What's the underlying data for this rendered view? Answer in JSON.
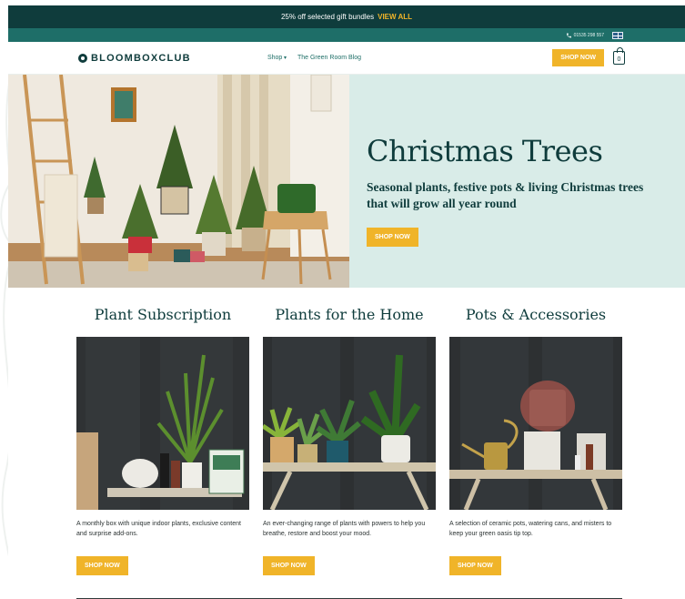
{
  "announcement": {
    "text": "25% off selected gift bundles",
    "link": "VIEW ALL"
  },
  "utility": {
    "phone": "01535 298 557"
  },
  "nav": {
    "logo": "BLOOMBOXCLUB",
    "links": [
      {
        "label": "Shop",
        "has_caret": true
      },
      {
        "label": "The Green Room Blog",
        "has_caret": false
      }
    ],
    "shop_now": "SHOP NOW",
    "cart_count": "0"
  },
  "hero": {
    "title": "Christmas Trees",
    "subtitle": "Seasonal plants, festive pots & living Christmas trees that will grow all year round",
    "button": "SHOP NOW"
  },
  "categories": [
    {
      "title": "Plant Subscription",
      "description": "A monthly box with unique indoor plants, exclusive content and surprise add-ons.",
      "button": "SHOP NOW"
    },
    {
      "title": "Plants for the Home",
      "description": "An ever-changing range of plants with powers to help you breathe, restore and boost your mood.",
      "button": "SHOP NOW"
    },
    {
      "title": "Pots & Accessories",
      "description": "A selection of ceramic pots, watering cans, and misters to keep your green oasis tip top.",
      "button": "SHOP NOW"
    }
  ],
  "colors": {
    "dark_teal": "#0f3c3c",
    "utility_teal": "#1e6e68",
    "mint": "#d9ece8",
    "accent": "#f0b429"
  },
  "icons": [
    "phone-icon",
    "uk-flag-icon",
    "logo-mark-icon",
    "chevron-down-icon",
    "shopping-bag-icon"
  ]
}
